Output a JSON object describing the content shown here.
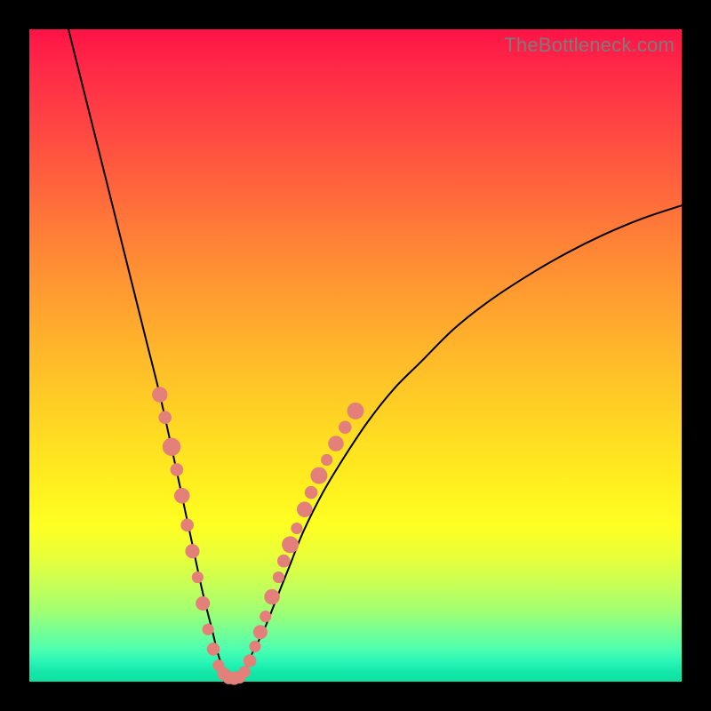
{
  "watermark": "TheBottleneck.com",
  "colors": {
    "frame": "#000000",
    "curve": "#000000",
    "dot_fill": "#e28079",
    "dot_stroke": "#c96a63",
    "gradient_top": "#ff1347",
    "gradient_bottom": "#0ee19f"
  },
  "chart_data": {
    "type": "line",
    "title": "",
    "xlabel": "",
    "ylabel": "",
    "xlim": [
      0,
      100
    ],
    "ylim": [
      0,
      100
    ],
    "series": [
      {
        "name": "bottleneck-curve",
        "x": [
          6,
          8,
          10,
          12,
          14,
          16,
          18,
          20,
          22,
          23.5,
          25,
          26.5,
          28,
          29,
          30,
          31,
          32,
          33,
          34,
          36,
          38,
          40,
          42,
          45,
          48,
          52,
          56,
          60,
          65,
          70,
          76,
          82,
          88,
          94,
          100
        ],
        "y": [
          100,
          92,
          84,
          76,
          68,
          60,
          52,
          44,
          35,
          28,
          21,
          14,
          8,
          4,
          1.5,
          0.5,
          0.5,
          1.5,
          4,
          8,
          13,
          18,
          23,
          29,
          34,
          40,
          45,
          49,
          54,
          58,
          62,
          65.5,
          68.5,
          71,
          73
        ]
      }
    ],
    "dots": {
      "name": "highlight-dots",
      "points": [
        {
          "x": 20.0,
          "y": 44.0,
          "r": 1.2
        },
        {
          "x": 20.8,
          "y": 40.5,
          "r": 1.0
        },
        {
          "x": 21.8,
          "y": 36.0,
          "r": 1.4
        },
        {
          "x": 22.6,
          "y": 32.5,
          "r": 1.0
        },
        {
          "x": 23.4,
          "y": 28.5,
          "r": 1.2
        },
        {
          "x": 24.2,
          "y": 24.0,
          "r": 1.0
        },
        {
          "x": 25.0,
          "y": 20.0,
          "r": 1.1
        },
        {
          "x": 25.8,
          "y": 16.0,
          "r": 0.9
        },
        {
          "x": 26.6,
          "y": 12.0,
          "r": 1.1
        },
        {
          "x": 27.4,
          "y": 8.0,
          "r": 0.9
        },
        {
          "x": 28.2,
          "y": 5.0,
          "r": 1.0
        },
        {
          "x": 29.0,
          "y": 2.5,
          "r": 0.9
        },
        {
          "x": 29.8,
          "y": 1.2,
          "r": 1.0
        },
        {
          "x": 30.6,
          "y": 0.6,
          "r": 1.0
        },
        {
          "x": 31.4,
          "y": 0.5,
          "r": 1.0
        },
        {
          "x": 32.2,
          "y": 0.7,
          "r": 1.0
        },
        {
          "x": 33.0,
          "y": 1.5,
          "r": 0.9
        },
        {
          "x": 33.8,
          "y": 3.2,
          "r": 1.0
        },
        {
          "x": 34.6,
          "y": 5.4,
          "r": 0.9
        },
        {
          "x": 35.4,
          "y": 7.6,
          "r": 1.1
        },
        {
          "x": 36.2,
          "y": 10.0,
          "r": 0.9
        },
        {
          "x": 37.2,
          "y": 13.0,
          "r": 1.2
        },
        {
          "x": 38.2,
          "y": 16.0,
          "r": 0.9
        },
        {
          "x": 39.0,
          "y": 18.5,
          "r": 1.0
        },
        {
          "x": 40.0,
          "y": 21.0,
          "r": 1.3
        },
        {
          "x": 41.0,
          "y": 23.5,
          "r": 0.9
        },
        {
          "x": 42.2,
          "y": 26.4,
          "r": 1.2
        },
        {
          "x": 43.2,
          "y": 29.0,
          "r": 1.0
        },
        {
          "x": 44.4,
          "y": 31.6,
          "r": 1.3
        },
        {
          "x": 45.6,
          "y": 34.0,
          "r": 0.9
        },
        {
          "x": 47.0,
          "y": 36.5,
          "r": 1.2
        },
        {
          "x": 48.4,
          "y": 39.0,
          "r": 1.0
        },
        {
          "x": 50.0,
          "y": 41.5,
          "r": 1.3
        }
      ]
    }
  }
}
